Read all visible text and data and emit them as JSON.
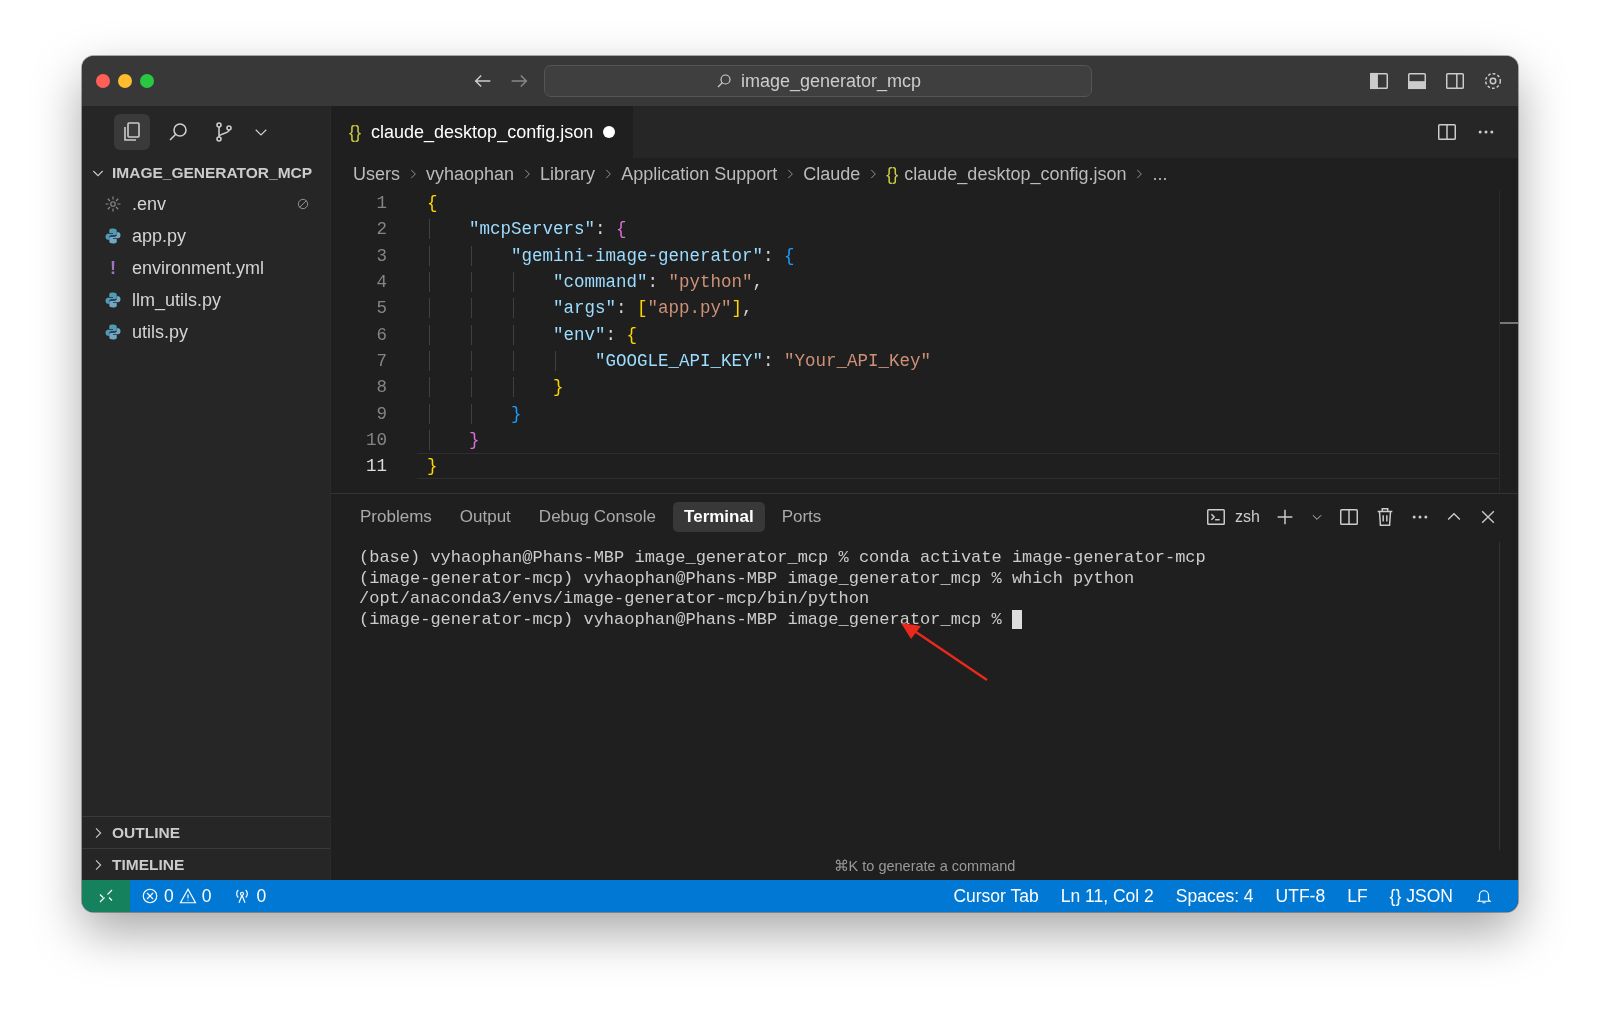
{
  "title_bar": {
    "search": "image_generator_mcp"
  },
  "activity": [
    {
      "kind": "files",
      "selected": true
    },
    {
      "kind": "search",
      "selected": false
    },
    {
      "kind": "source",
      "selected": false
    }
  ],
  "explorer": {
    "folder": "IMAGE_GENERATOR_MCP",
    "expanded": true,
    "files": [
      {
        "name": ".env",
        "kind": "config",
        "ignored": true
      },
      {
        "name": "app.py",
        "kind": "python",
        "ignored": false
      },
      {
        "name": "environment.yml",
        "kind": "yaml",
        "icon_text": "!",
        "ignored": false
      },
      {
        "name": "llm_utils.py",
        "kind": "python",
        "ignored": false
      },
      {
        "name": "utils.py",
        "kind": "python",
        "ignored": false
      }
    ],
    "sections": [
      {
        "label": "OUTLINE",
        "expanded": false
      },
      {
        "label": "TIMELINE",
        "expanded": false
      }
    ]
  },
  "editor_tab": {
    "icon_text": "{}",
    "label": "claude_desktop_config.json",
    "modified": true
  },
  "breadcrumb": [
    "Users",
    "vyhaophan",
    "Library",
    "Application Support",
    "Claude",
    {
      "icon_text": "{}",
      "label": "claude_desktop_config.json"
    },
    "..."
  ],
  "code": [
    {
      "number": "1",
      "current": false,
      "tokens": [
        {
          "kind": "bracket",
          "text": "{",
          "color": "#ffd700"
        }
      ]
    },
    {
      "number": "2",
      "current": false,
      "tokens": [
        {
          "kind": "key",
          "text": "    \"mcpServers\""
        },
        {
          "kind": "punct",
          "text": ": "
        },
        {
          "kind": "bracket",
          "text": "{",
          "color": "#da70d6"
        }
      ]
    },
    {
      "number": "3",
      "current": false,
      "tokens": [
        {
          "kind": "key",
          "text": "        \"gemini-image-generator\""
        },
        {
          "kind": "punct",
          "text": ": "
        },
        {
          "kind": "bracket",
          "text": "{",
          "color": "#179fff"
        }
      ]
    },
    {
      "number": "4",
      "current": false,
      "tokens": [
        {
          "kind": "key",
          "text": "            \"command\""
        },
        {
          "kind": "punct",
          "text": ": "
        },
        {
          "kind": "string",
          "text": "\"python\""
        },
        {
          "kind": "punct",
          "text": ","
        }
      ]
    },
    {
      "number": "5",
      "current": false,
      "tokens": [
        {
          "kind": "key",
          "text": "            \"args\""
        },
        {
          "kind": "punct",
          "text": ": "
        },
        {
          "kind": "bracket",
          "text": "[",
          "color": "#ffd700"
        },
        {
          "kind": "string",
          "text": "\"app.py\""
        },
        {
          "kind": "bracket",
          "text": "]",
          "color": "#ffd700"
        },
        {
          "kind": "punct",
          "text": ","
        }
      ]
    },
    {
      "number": "6",
      "current": false,
      "tokens": [
        {
          "kind": "key",
          "text": "            \"env\""
        },
        {
          "kind": "punct",
          "text": ": "
        },
        {
          "kind": "bracket",
          "text": "{",
          "color": "#ffd700"
        }
      ]
    },
    {
      "number": "7",
      "current": false,
      "tokens": [
        {
          "kind": "key",
          "text": "                \"GOOGLE_API_KEY\""
        },
        {
          "kind": "punct",
          "text": ": "
        },
        {
          "kind": "string",
          "text": "\"Your_API_Key\""
        }
      ]
    },
    {
      "number": "8",
      "current": false,
      "tokens": [
        {
          "kind": "bracket",
          "text": "            }",
          "color": "#ffd700"
        }
      ]
    },
    {
      "number": "9",
      "current": false,
      "tokens": [
        {
          "kind": "bracket",
          "text": "        }",
          "color": "#179fff"
        }
      ]
    },
    {
      "number": "10",
      "current": false,
      "tokens": [
        {
          "kind": "bracket",
          "text": "    }",
          "color": "#da70d6"
        }
      ]
    },
    {
      "number": "11",
      "current": true,
      "tokens": [
        {
          "kind": "bracket",
          "text": "}",
          "color": "#ffd700"
        }
      ]
    }
  ],
  "panel": {
    "tabs": [
      {
        "label": "Problems",
        "selected": false
      },
      {
        "label": "Output",
        "selected": false
      },
      {
        "label": "Debug Console",
        "selected": false
      },
      {
        "label": "Terminal",
        "selected": true
      },
      {
        "label": "Ports",
        "selected": false
      }
    ],
    "shell": "zsh",
    "terminal": [
      "(base) vyhaophan@Phans-MBP image_generator_mcp % conda activate image-generator-mcp",
      "(image-generator-mcp) vyhaophan@Phans-MBP image_generator_mcp % which python",
      "/opt/anaconda3/envs/image-generator-mcp/bin/python",
      "(image-generator-mcp) vyhaophan@Phans-MBP image_generator_mcp % "
    ],
    "hint": "⌘K to generate a command"
  },
  "status_bar": {
    "errors": "0",
    "warnings": "0",
    "ports": "0",
    "items": [
      "Cursor Tab",
      "Ln 11, Col 2",
      "Spaces: 4",
      "UTF-8",
      "LF"
    ],
    "language_icon": "{}",
    "language": "JSON"
  }
}
